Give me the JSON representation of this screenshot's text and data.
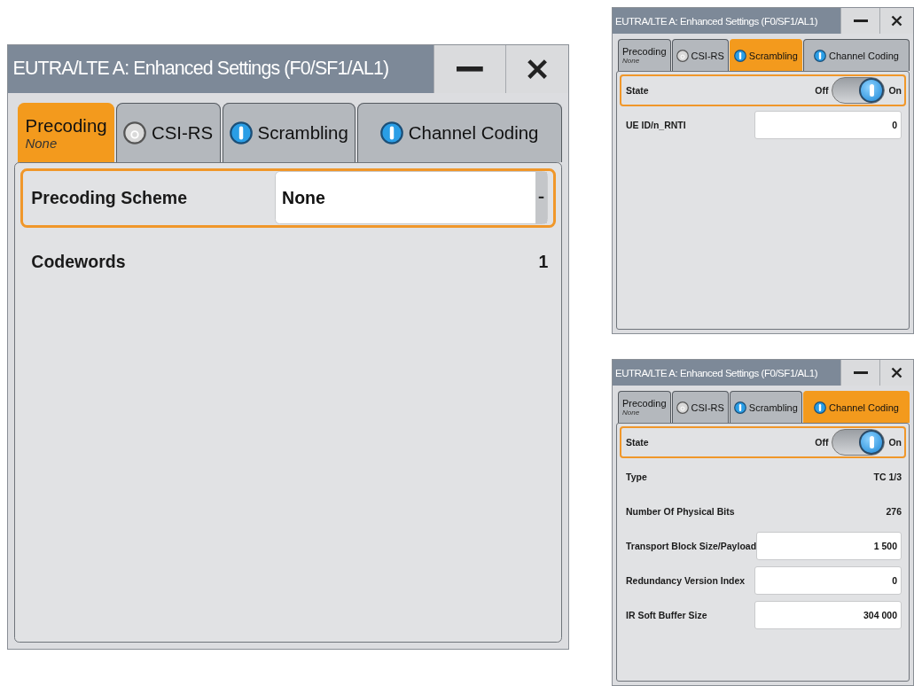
{
  "dialogs": [
    {
      "title": "EUTRA/LTE A: Enhanced Settings (F0/SF1/AL1)",
      "tabs": [
        {
          "label": "Precoding",
          "sublabel": "None",
          "selected": true
        },
        {
          "label": "CSI-RS",
          "active": false,
          "selected": false
        },
        {
          "label": "Scrambling",
          "active": true,
          "selected": false
        },
        {
          "label": "Channel Coding",
          "active": true,
          "selected": false
        }
      ],
      "rows": [
        {
          "kind": "dropdown",
          "label": "Precoding Scheme",
          "value": "None",
          "focused": true
        },
        {
          "kind": "value",
          "label": "Codewords",
          "value": "1",
          "focused": false
        }
      ]
    },
    {
      "title": "EUTRA/LTE A: Enhanced Settings (F0/SF1/AL1)",
      "tabs": [
        {
          "label": "Precoding",
          "sublabel": "None",
          "selected": false
        },
        {
          "label": "CSI-RS",
          "active": false,
          "selected": false
        },
        {
          "label": "Scrambling",
          "active": true,
          "selected": true
        },
        {
          "label": "Channel Coding",
          "active": true,
          "selected": false
        }
      ],
      "rows": [
        {
          "kind": "toggle",
          "label": "State",
          "off_label": "Off",
          "on_label": "On",
          "on": true,
          "focused": true
        },
        {
          "kind": "input",
          "label": "UE ID/n_RNTI",
          "value": "0",
          "focused": false
        }
      ]
    },
    {
      "title": "EUTRA/LTE A: Enhanced Settings (F0/SF1/AL1)",
      "tabs": [
        {
          "label": "Precoding",
          "sublabel": "None",
          "selected": false
        },
        {
          "label": "CSI-RS",
          "active": false,
          "selected": false
        },
        {
          "label": "Scrambling",
          "active": true,
          "selected": false
        },
        {
          "label": "Channel Coding",
          "active": true,
          "selected": true
        }
      ],
      "rows": [
        {
          "kind": "toggle",
          "label": "State",
          "off_label": "Off",
          "on_label": "On",
          "on": true,
          "focused": true
        },
        {
          "kind": "value",
          "label": "Type",
          "value": "TC 1/3",
          "focused": false
        },
        {
          "kind": "value",
          "label": "Number Of Physical Bits",
          "value": "276",
          "focused": false
        },
        {
          "kind": "input",
          "label": "Transport Block Size/Payload",
          "value": "1 500",
          "focused": false
        },
        {
          "kind": "input",
          "label": "Redundancy Version Index",
          "value": "0",
          "focused": false
        },
        {
          "kind": "input",
          "label": "IR Soft Buffer Size",
          "value": "304 000",
          "focused": false
        }
      ]
    }
  ]
}
